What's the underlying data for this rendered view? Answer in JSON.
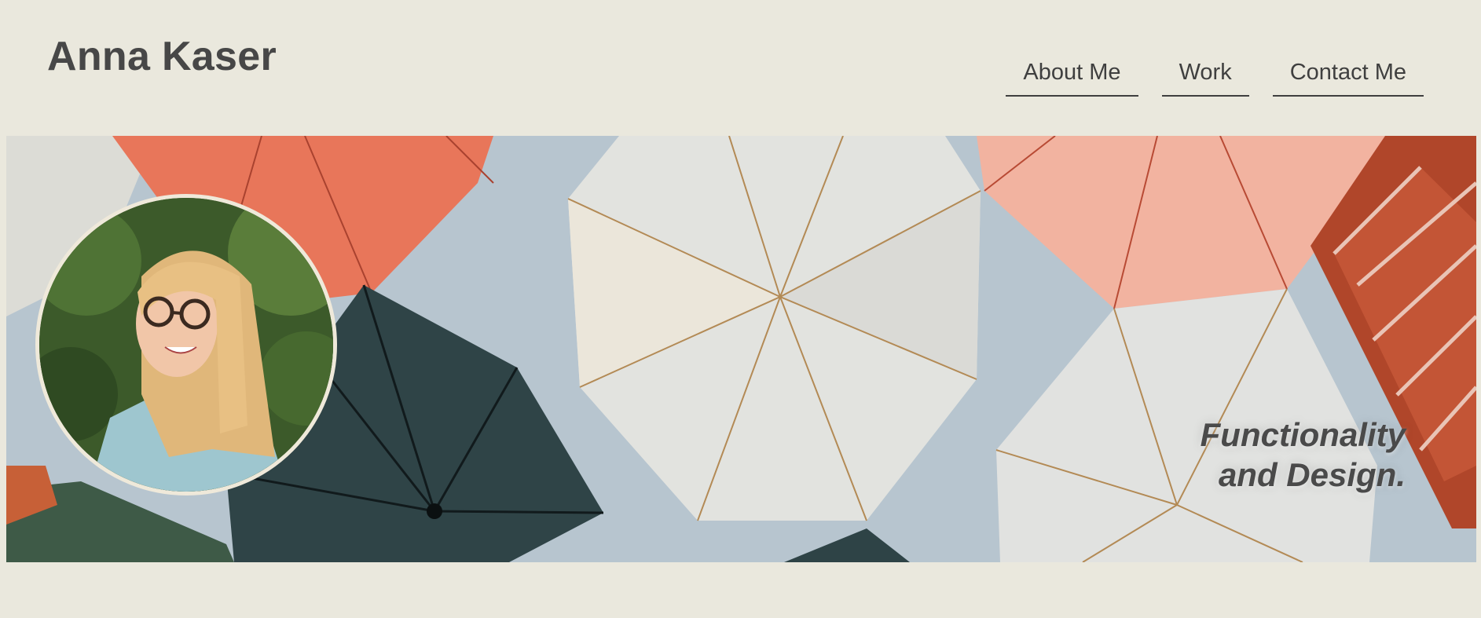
{
  "header": {
    "site_title": "Anna Kaser",
    "nav": [
      {
        "label": "About Me"
      },
      {
        "label": "Work"
      },
      {
        "label": "Contact Me"
      }
    ]
  },
  "hero": {
    "tagline_line1": "Functionality",
    "tagline_line2": "and Design.",
    "background": "umbrellas-photo",
    "colors": {
      "sky": "#b8c6d0",
      "umbrella_coral": "#e8765a",
      "umbrella_peach": "#f2b3a0",
      "umbrella_white": "#e3e4e1",
      "umbrella_dark": "#2e4346",
      "umbrella_green": "#3e5a47"
    }
  },
  "profile": {
    "photo": "portrait-photo"
  },
  "theme": {
    "background": "#eae8dd",
    "text": "#474747"
  }
}
